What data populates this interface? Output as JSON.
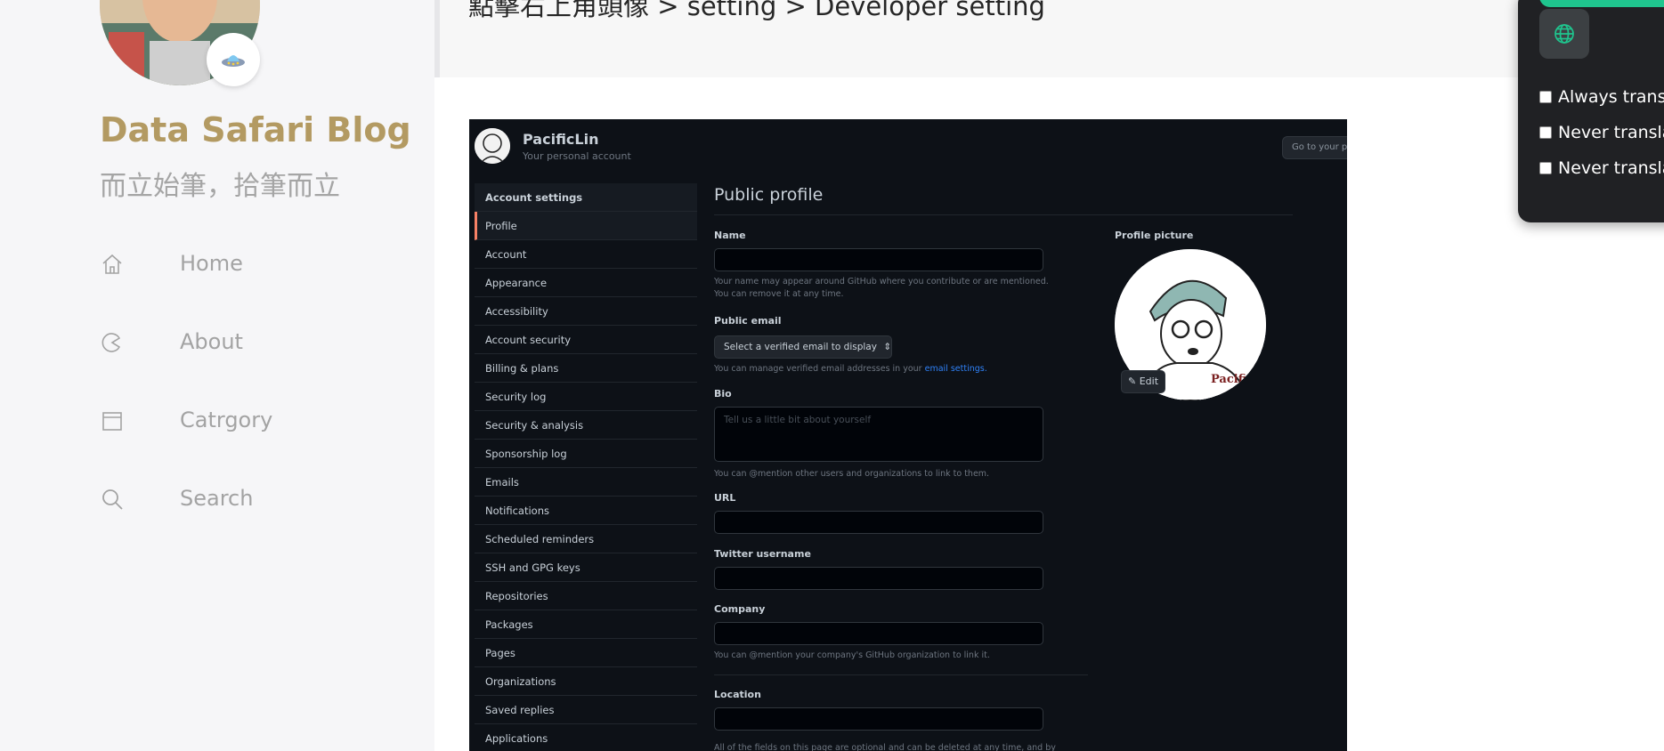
{
  "sidebar": {
    "title": "Data Safari Blog",
    "subtitle": "而立始筆，拾筆而立",
    "nav": [
      {
        "label": "Home",
        "icon": "home-icon"
      },
      {
        "label": "About",
        "icon": "palette-icon"
      },
      {
        "label": "Catrgory",
        "icon": "calendar-icon"
      },
      {
        "label": "Search",
        "icon": "search-icon"
      }
    ],
    "badge_icon": "ufo-icon"
  },
  "article": {
    "breadcrumb": "點擊右上角頭像 > setting > Developer setting"
  },
  "github_screenshot": {
    "username": "PacificLin",
    "account_type": "Your personal account",
    "goto_button": "Go to your personal profile",
    "menu_heading": "Account settings",
    "menu": [
      "Profile",
      "Account",
      "Appearance",
      "Accessibility",
      "Account security",
      "Billing & plans",
      "Security log",
      "Security & analysis",
      "Sponsorship log",
      "Emails",
      "Notifications",
      "Scheduled reminders",
      "SSH and GPG keys",
      "Repositories",
      "Packages",
      "Pages",
      "Organizations",
      "Saved replies",
      "Applications"
    ],
    "active_menu": "Profile",
    "page_title": "Public profile",
    "name_label": "Name",
    "name_note": "Your name may appear around GitHub where you contribute or are mentioned. You can remove it at any time.",
    "email_label": "Public email",
    "email_select": "Select a verified email to display",
    "email_note_prefix": "You can manage verified email addresses in your",
    "email_note_link": "email settings.",
    "bio_label": "Bio",
    "bio_placeholder": "Tell us a little bit about yourself",
    "bio_note": "You can @mention other users and organizations to link to them.",
    "url_label": "URL",
    "twitter_label": "Twitter username",
    "company_label": "Company",
    "company_note": "You can @mention your company's GitHub organization to link it.",
    "location_label": "Location",
    "footer_note": "All of the fields on this page are optional and can be deleted at any time, and by filling them",
    "picture_label": "Profile picture",
    "edit_button": "Edit",
    "avatar_text": "Pacific"
  },
  "translate_popup": {
    "options": [
      "Always trans",
      "Never transla",
      "Never transla"
    ],
    "accent_color": "#1fc58e",
    "icon": "globe-icon"
  },
  "colors": {
    "brand": "#b39a62",
    "nav_text": "#a3a3a3",
    "github_bg": "#0d1117"
  }
}
